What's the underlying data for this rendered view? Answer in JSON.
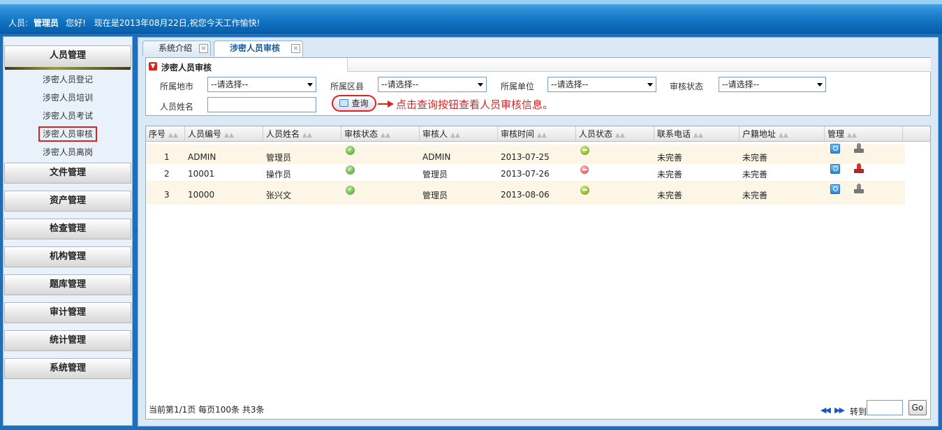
{
  "header": {
    "user_prefix": "人员:",
    "user_name": "管理员",
    "greeting": "您好!",
    "date_message": "现在是2013年08月22日,祝您今天工作愉快!"
  },
  "sidebar": {
    "active_menu": "人员管理",
    "sub_items": [
      "涉密人员登记",
      "涉密人员培训",
      "涉密人员考试",
      "涉密人员审核",
      "涉密人员离岗"
    ],
    "selected_sub": "涉密人员审核",
    "menus": [
      "文件管理",
      "资产管理",
      "检查管理",
      "机构管理",
      "题库管理",
      "审计管理",
      "统计管理",
      "系统管理"
    ],
    "collapse_glyph": "«"
  },
  "tabs": [
    {
      "label": "系统介绍"
    },
    {
      "label": "涉密人员审核"
    }
  ],
  "panel": {
    "title": "涉密人员审核",
    "city_label": "所属地市",
    "district_label": "所属区县",
    "unit_label": "所属单位",
    "status_label": "审核状态",
    "name_label": "人员姓名",
    "select_default": "--请选择--",
    "query_label": "查询",
    "hint": "点击查询按钮查看人员审核信息。"
  },
  "grid": {
    "columns": [
      "序号",
      "人员编号",
      "人员姓名",
      "审核状态",
      "审核人",
      "审核时间",
      "人员状态",
      "联系电话",
      "户籍地址",
      "管理"
    ],
    "rows": [
      {
        "no": "1",
        "id": "ADMIN",
        "name": "管理员",
        "reviewer": "ADMIN",
        "time": "2013-07-25",
        "person_status": "green",
        "phone": "未完善",
        "address": "未完善"
      },
      {
        "no": "2",
        "id": "10001",
        "name": "操作员",
        "reviewer": "管理员",
        "time": "2013-07-26",
        "person_status": "red",
        "phone": "未完善",
        "address": "未完善"
      },
      {
        "no": "3",
        "id": "10000",
        "name": "张兴文",
        "reviewer": "管理员",
        "time": "2013-08-06",
        "person_status": "green",
        "phone": "未完善",
        "address": "未完善"
      }
    ],
    "page_info": "当前第1/1页 每页100条 共3条",
    "goto_label": "转到",
    "go_label": "Go"
  }
}
